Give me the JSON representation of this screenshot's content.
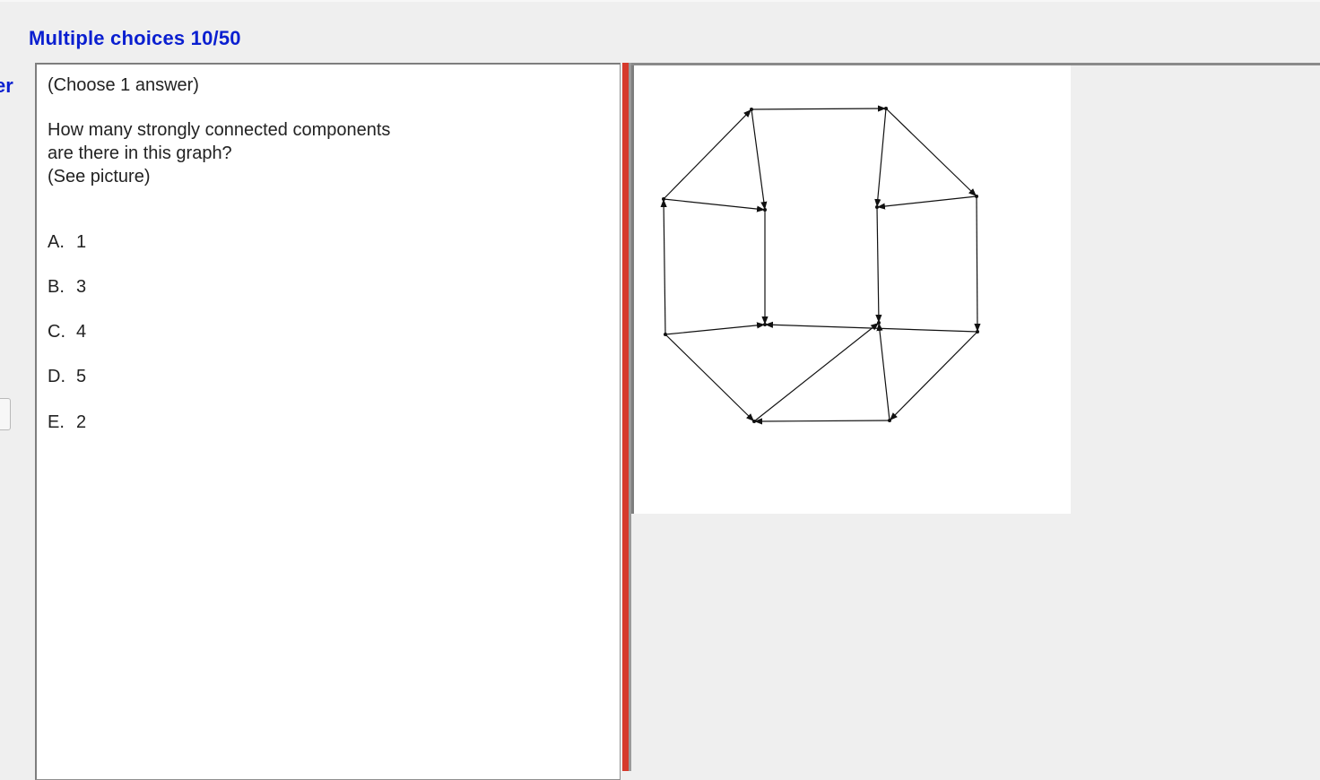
{
  "header": {
    "title": "Multiple choices 10/50"
  },
  "left_edge": {
    "clipped_text": "er"
  },
  "question": {
    "instruction": "(Choose 1 answer)",
    "lines": [
      "How many strongly connected components",
      "are there in this graph?",
      "(See picture)"
    ]
  },
  "choices": [
    {
      "letter": "A.",
      "value": "1"
    },
    {
      "letter": "B.",
      "value": "3"
    },
    {
      "letter": "C.",
      "value": "4"
    },
    {
      "letter": "D.",
      "value": "5"
    },
    {
      "letter": "E.",
      "value": "2"
    }
  ],
  "graph": {
    "colors": {
      "edge": "#111111",
      "accent": "#d63a2c"
    },
    "node_count": 12,
    "edge_list": [
      [
        1,
        2
      ],
      [
        0,
        1
      ],
      [
        2,
        3
      ],
      [
        3,
        4
      ],
      [
        4,
        5
      ],
      [
        5,
        6
      ],
      [
        7,
        6
      ],
      [
        7,
        0
      ],
      [
        0,
        8
      ],
      [
        1,
        8
      ],
      [
        8,
        11
      ],
      [
        3,
        9
      ],
      [
        2,
        9
      ],
      [
        9,
        10
      ],
      [
        5,
        10
      ],
      [
        4,
        11
      ],
      [
        6,
        10
      ],
      [
        7,
        11
      ]
    ]
  }
}
